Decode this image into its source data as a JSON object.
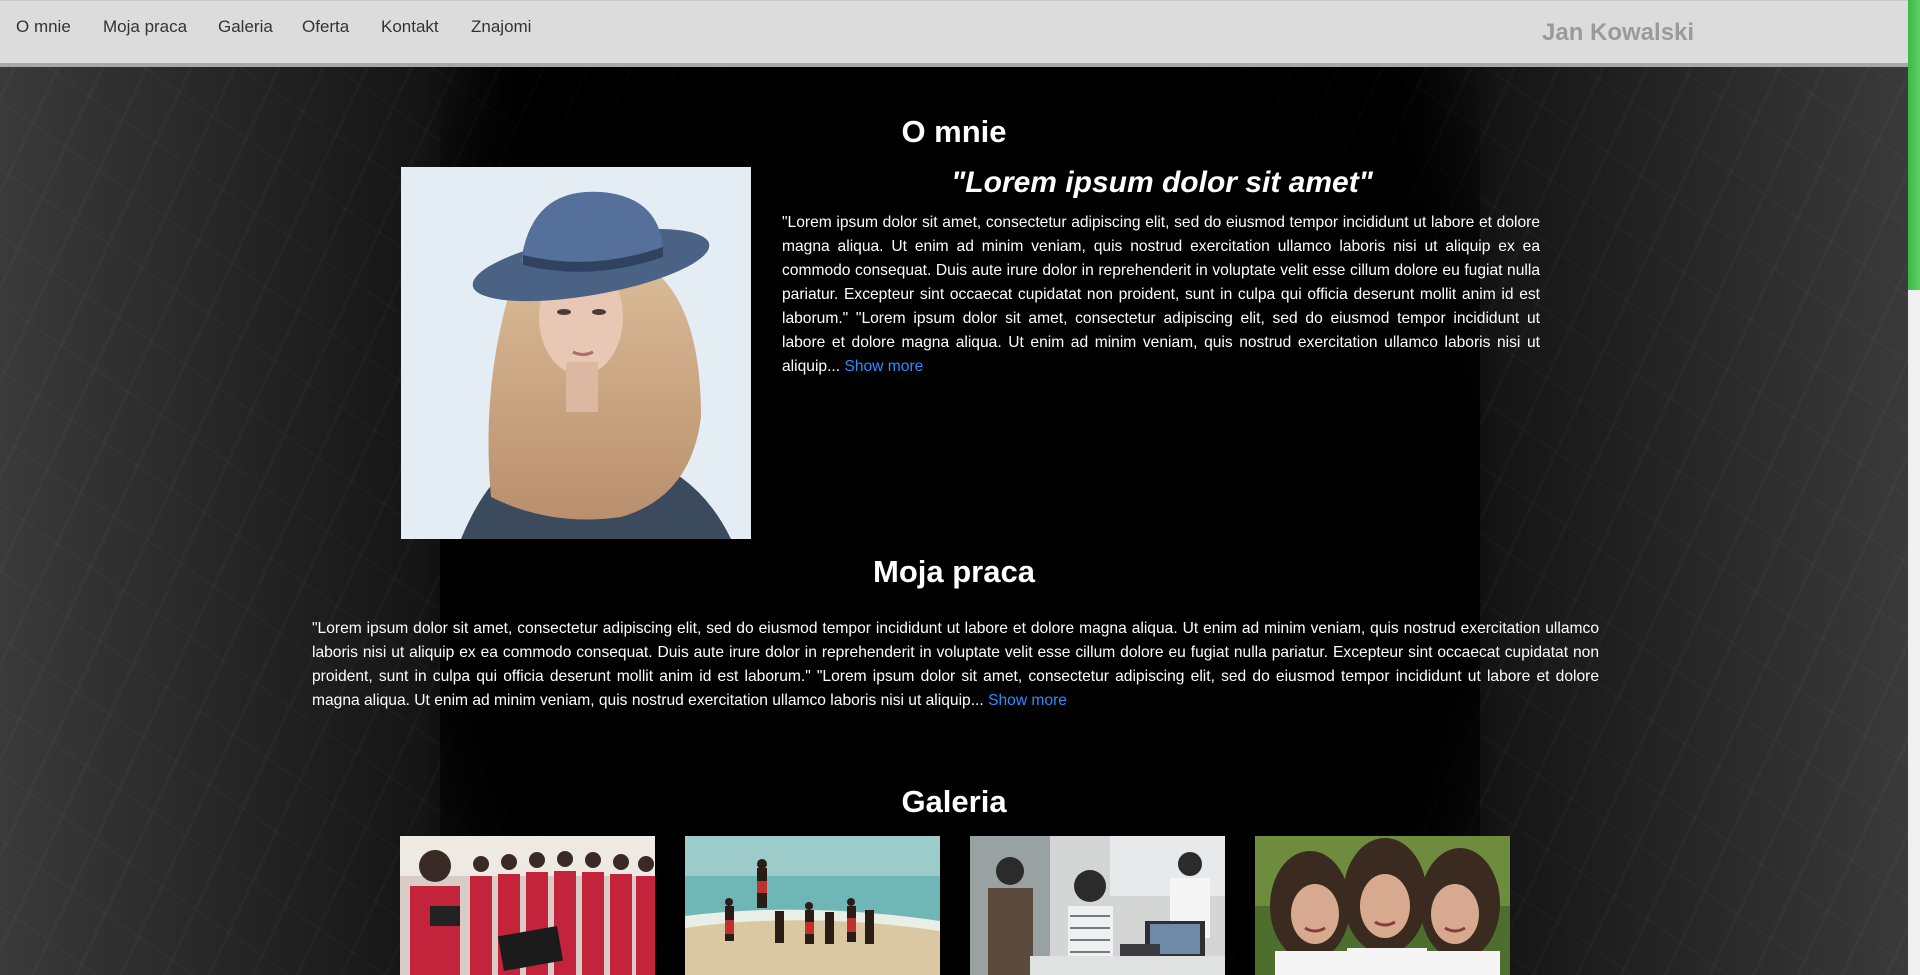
{
  "nav": {
    "items": [
      "O mnie",
      "Moja praca",
      "Galeria",
      "Oferta",
      "Kontakt",
      "Znajomi"
    ],
    "brand": "Jan Kowalski"
  },
  "about": {
    "heading": "O mnie",
    "quote": "\"Lorem ipsum dolor sit amet\"",
    "text": "\"Lorem ipsum dolor sit amet, consectetur adipiscing elit, sed do eiusmod tempor incididunt ut labore et dolore magna aliqua. Ut enim ad minim veniam, quis nostrud exercitation ullamco laboris nisi ut aliquip ex ea commodo consequat. Duis aute irure dolor in reprehenderit in voluptate velit esse cillum dolore eu fugiat nulla pariatur. Excepteur sint occaecat cupidatat non proident, sunt in culpa qui officia deserunt mollit anim id est laborum.\" \"Lorem ipsum dolor sit amet, consectetur adipiscing elit, sed do eiusmod tempor incididunt ut labore et dolore magna aliqua. Ut enim ad minim veniam, quis nostrud exercitation ullamco laboris nisi ut aliquip...",
    "show_more": "Show more"
  },
  "work": {
    "heading": "Moja praca",
    "text": "\"Lorem ipsum dolor sit amet, consectetur adipiscing elit, sed do eiusmod tempor incididunt ut labore et dolore magna aliqua. Ut enim ad minim veniam, quis nostrud exercitation ullamco laboris nisi ut aliquip ex ea commodo consequat. Duis aute irure dolor in reprehenderit in voluptate velit esse cillum dolore eu fugiat nulla pariatur. Excepteur sint occaecat cupidatat non proident, sunt in culpa qui officia deserunt mollit anim id est laborum.\" \"Lorem ipsum dolor sit amet, consectetur adipiscing elit, sed do eiusmod tempor incididunt ut labore et dolore magna aliqua. Ut enim ad minim veniam, quis nostrud exercitation ullamco laboris nisi ut aliquip...",
    "show_more": "Show more"
  },
  "gallery": {
    "heading": "Galeria",
    "images": [
      "choir-photo",
      "beach-people-photo",
      "office-meeting-photo",
      "women-friends-photo"
    ]
  },
  "colors": {
    "link": "#2e8cff",
    "navbar_bg": "#dcdcdc",
    "brand": "#9a9a9a",
    "scroll_accent": "#3fb64a"
  }
}
